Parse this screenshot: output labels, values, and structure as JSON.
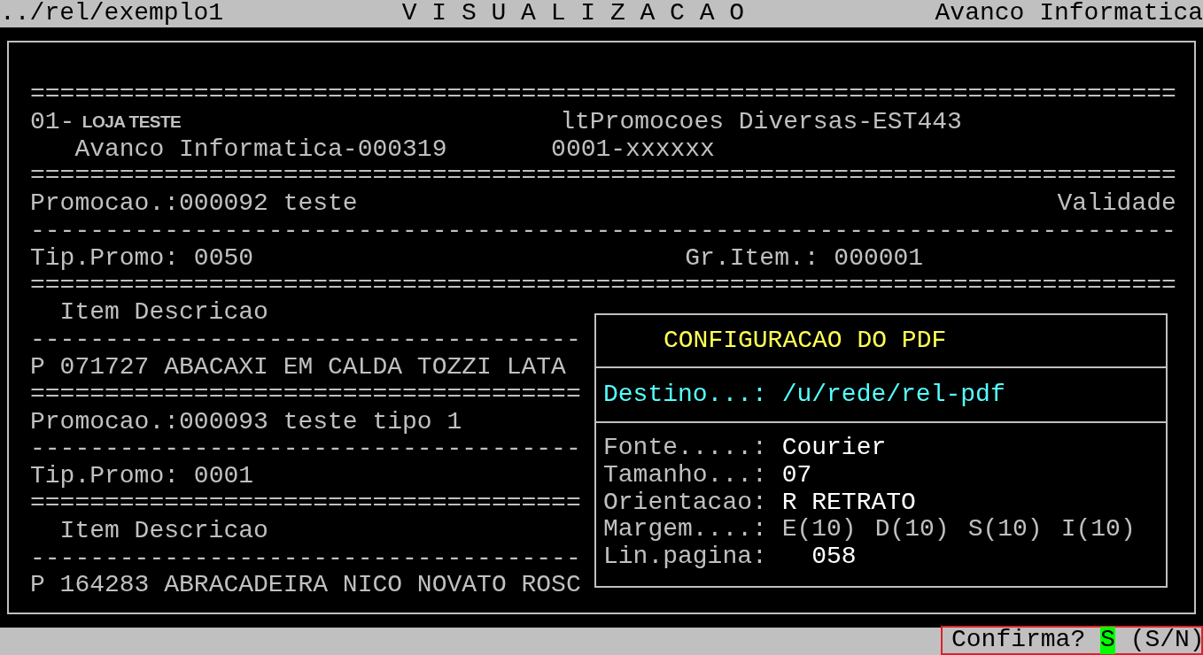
{
  "header": {
    "path": "../rel/exemplo1",
    "title": "V I S U A L I Z A C A O",
    "company": "Avanco Informatica"
  },
  "report": {
    "rows": [
      {
        "segments": [
          "============================================================================="
        ]
      },
      {
        "segments": [
          "01-",
          "LOJA TESTE",
          "ltPromocoes Diversas-EST443"
        ]
      },
      {
        "segments": [
          "Avanco Informatica-000319",
          "0001-xxxxxx"
        ]
      },
      {
        "segments": [
          "============================================================================="
        ]
      },
      {
        "segments": [
          "Promocao.:000092 teste",
          "Validade"
        ]
      },
      {
        "segments": [
          "-----------------------------------------------------------------------------"
        ]
      },
      {
        "segments": [
          "Tip.Promo: 0050",
          "Gr.Item.: 000001"
        ]
      },
      {
        "segments": [
          "============================================================================="
        ]
      },
      {
        "segments": [
          "Item Descricao"
        ]
      },
      {
        "segments": [
          "-------------------------------------"
        ]
      },
      {
        "segments": [
          "P 071727 ABACAXI EM CALDA TOZZI LATA"
        ]
      },
      {
        "segments": [
          "====================================="
        ]
      },
      {
        "segments": [
          "Promocao.:000093 teste tipo 1"
        ]
      },
      {
        "segments": [
          "-------------------------------------"
        ]
      },
      {
        "segments": [
          "Tip.Promo: 0001"
        ]
      },
      {
        "segments": [
          "====================================="
        ]
      },
      {
        "segments": [
          "Item Descricao"
        ]
      },
      {
        "segments": [
          "-------------------------------------"
        ]
      },
      {
        "segments": [
          "P 164283 ABRACADEIRA NICO NOVATO ROSC"
        ]
      }
    ]
  },
  "dialog": {
    "title": "CONFIGURACAO DO PDF",
    "destination": {
      "label": "Destino...:",
      "value": "/u/rede/rel-pdf"
    },
    "fields": [
      {
        "label": "Fonte.....:",
        "value": "Courier"
      },
      {
        "label": "Tamanho...:",
        "value": "07"
      },
      {
        "label": "Orientacao:",
        "value": "R RETRATO"
      },
      {
        "label": "Margem....:",
        "values": [
          "E(10)",
          "D(10)",
          "S(10)",
          "I(10)"
        ]
      },
      {
        "label": "Lin.pagina:",
        "value": "058"
      }
    ]
  },
  "status_bar": {
    "prompt": "Confirma?",
    "answer": "S",
    "options": "(S/N)"
  }
}
